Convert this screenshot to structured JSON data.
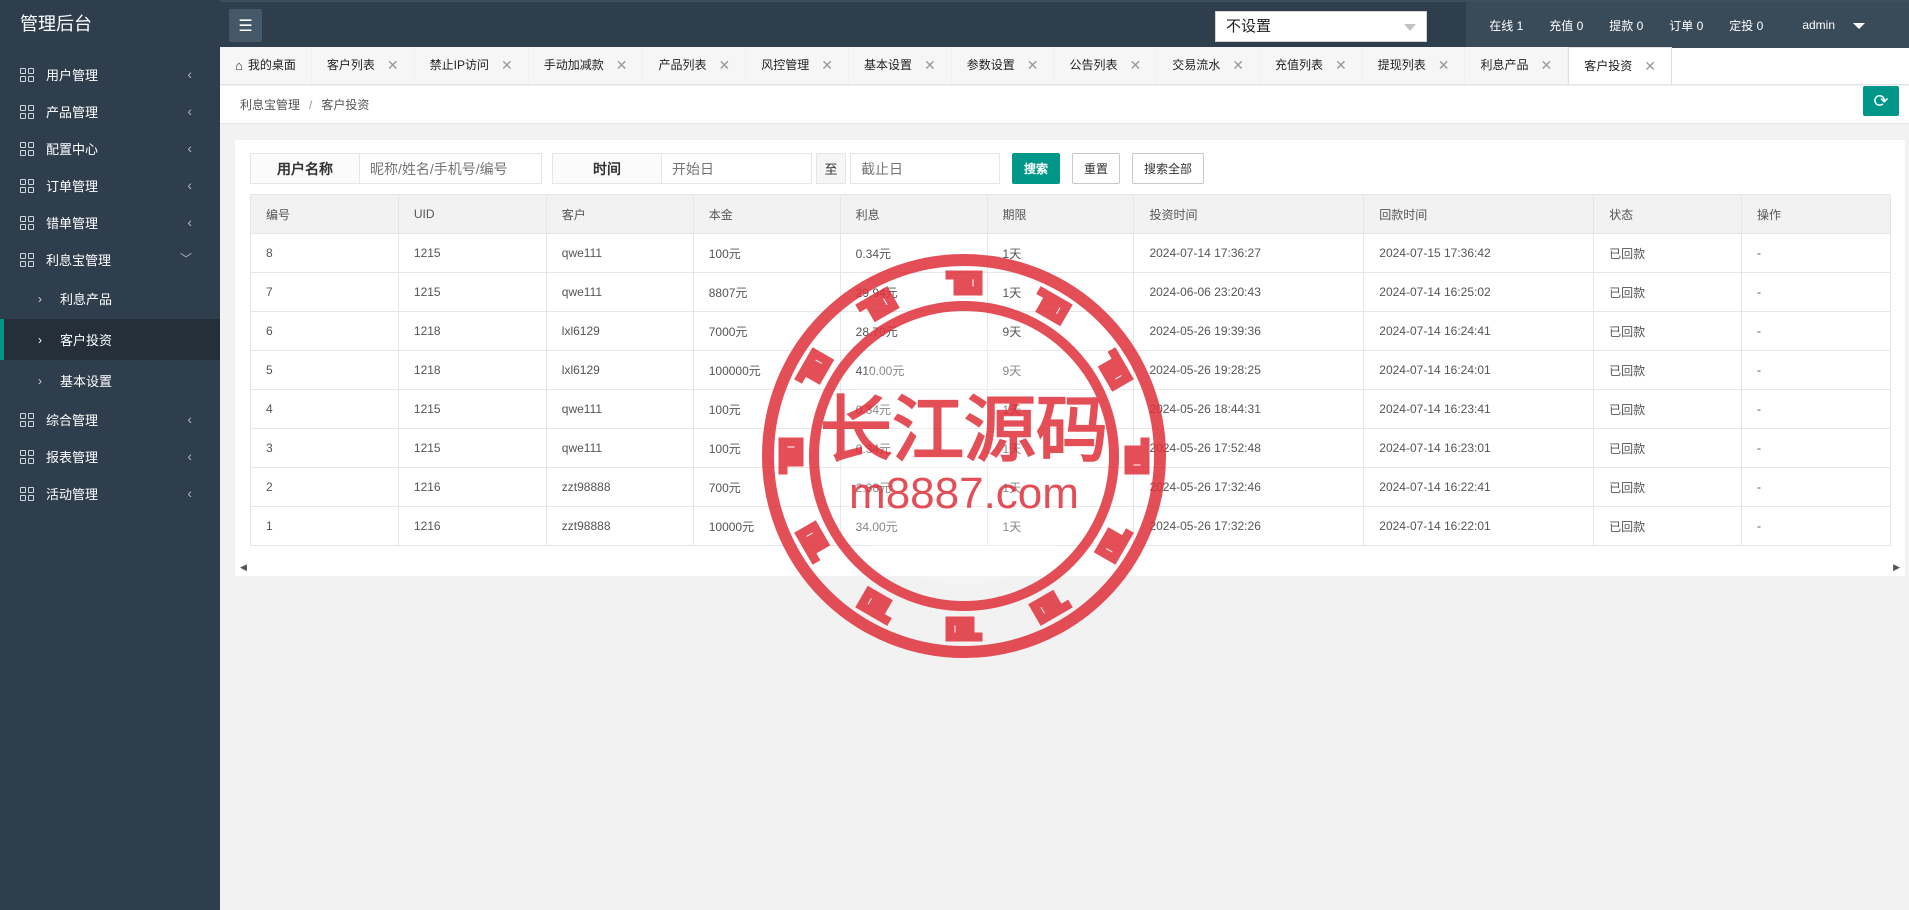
{
  "app": {
    "title": "管理后台"
  },
  "sidebar": {
    "items": [
      {
        "label": "用户管理"
      },
      {
        "label": "产品管理"
      },
      {
        "label": "配置中心"
      },
      {
        "label": "订单管理"
      },
      {
        "label": "错单管理"
      },
      {
        "label": "利息宝管理"
      },
      {
        "label": "综合管理"
      },
      {
        "label": "报表管理"
      },
      {
        "label": "活动管理"
      }
    ],
    "sub_items": [
      {
        "label": "利息产品"
      },
      {
        "label": "客户投资"
      },
      {
        "label": "基本设置"
      }
    ]
  },
  "topbar": {
    "select_value": "不设置",
    "stats": [
      "在线 1",
      "充值 0",
      "提款 0",
      "订单 0",
      "定投 0"
    ],
    "user": "admin"
  },
  "tabs": [
    "我的桌面",
    "客户列表",
    "禁止IP访问",
    "手动加减款",
    "产品列表",
    "风控管理",
    "基本设置",
    "参数设置",
    "公告列表",
    "交易流水",
    "充值列表",
    "提现列表",
    "利息产品",
    "客户投资"
  ],
  "breadcrumb": {
    "parent": "利息宝管理",
    "separator": "/",
    "current": "客户投资"
  },
  "filters": {
    "username_label": "用户名称",
    "username_placeholder": "昵称/姓名/手机号/编号",
    "time_label": "时间",
    "start_placeholder": "开始日",
    "to_label": "至",
    "end_placeholder": "截止日",
    "search_btn": "搜索",
    "reset_btn": "重置",
    "search_all_btn": "搜索全部"
  },
  "table": {
    "headers": [
      "编号",
      "UID",
      "客户",
      "本金",
      "利息",
      "期限",
      "投资时间",
      "回款时间",
      "状态",
      "操作"
    ],
    "rows": [
      [
        "8",
        "1215",
        "qwe111",
        "100元",
        "0.34元",
        "1天",
        "2024-07-14 17:36:27",
        "2024-07-15 17:36:42",
        "已回款",
        "-"
      ],
      [
        "7",
        "1215",
        "qwe111",
        "8807元",
        "29.94元",
        "1天",
        "2024-06-06 23:20:43",
        "2024-07-14 16:25:02",
        "已回款",
        "-"
      ],
      [
        "6",
        "1218",
        "lxl6129",
        "7000元",
        "28.70元",
        "9天",
        "2024-05-26 19:39:36",
        "2024-07-14 16:24:41",
        "已回款",
        "-"
      ],
      [
        "5",
        "1218",
        "lxl6129",
        "100000元",
        "410.00元",
        "9天",
        "2024-05-26 19:28:25",
        "2024-07-14 16:24:01",
        "已回款",
        "-"
      ],
      [
        "4",
        "1215",
        "qwe111",
        "100元",
        "0.34元",
        "1天",
        "2024-05-26 18:44:31",
        "2024-07-14 16:23:41",
        "已回款",
        "-"
      ],
      [
        "3",
        "1215",
        "qwe111",
        "100元",
        "0.34元",
        "1天",
        "2024-05-26 17:52:48",
        "2024-07-14 16:23:01",
        "已回款",
        "-"
      ],
      [
        "2",
        "1216",
        "zzt98888",
        "700元",
        "2.38元",
        "1天",
        "2024-05-26 17:32:46",
        "2024-07-14 16:22:41",
        "已回款",
        "-"
      ],
      [
        "1",
        "1216",
        "zzt98888",
        "10000元",
        "34.00元",
        "1天",
        "2024-05-26 17:32:26",
        "2024-07-14 16:22:01",
        "已回款",
        "-"
      ]
    ]
  },
  "watermark": {
    "line1": "长江源码",
    "line2": "m8887.com"
  },
  "colors": {
    "sidebar": "#2f3e4c",
    "accent": "#009688",
    "stamp": "#e0303a"
  }
}
